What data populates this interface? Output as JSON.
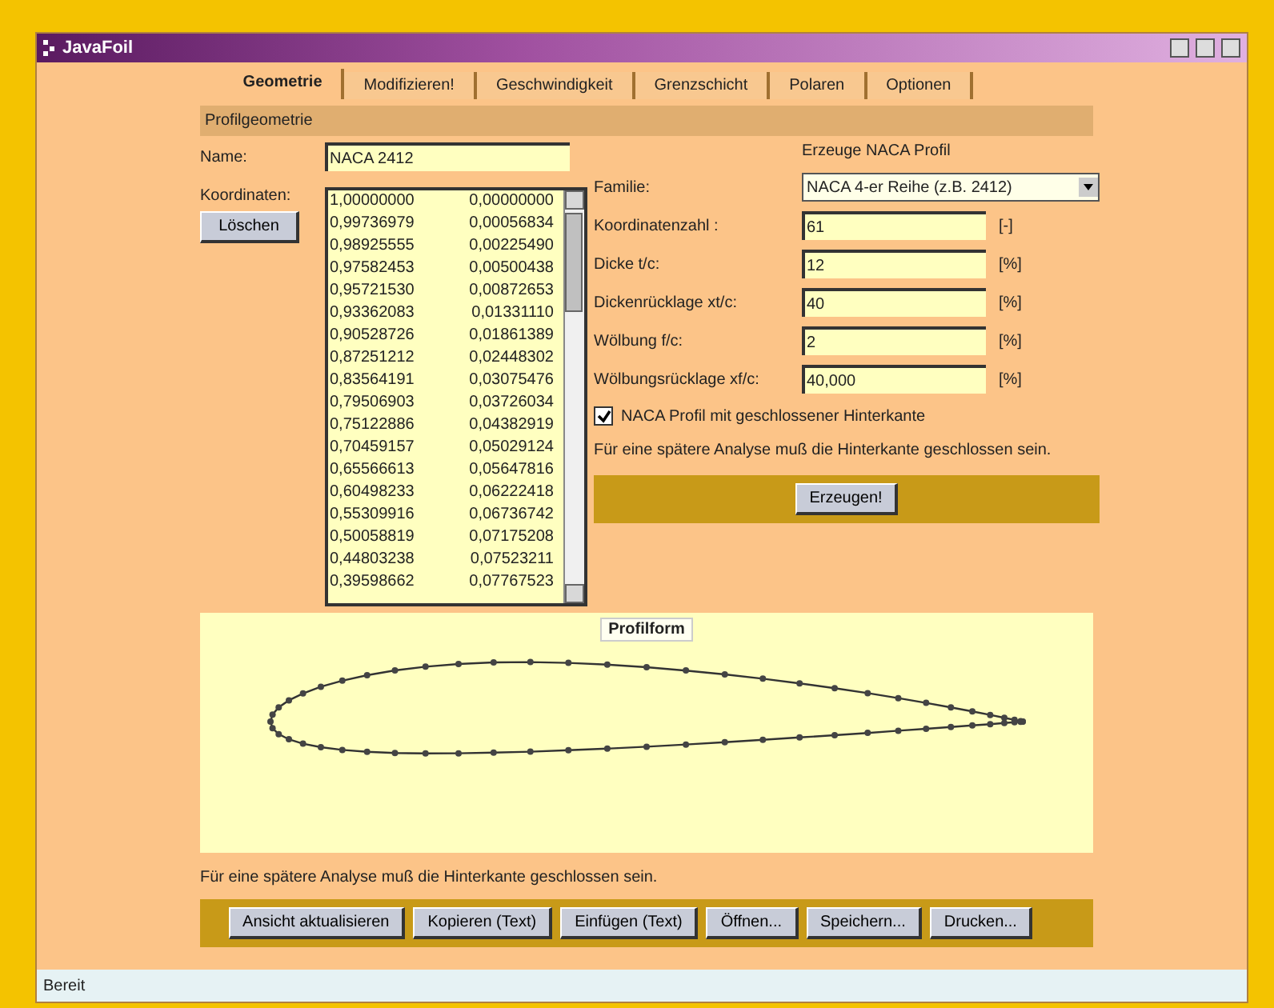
{
  "window": {
    "title": "JavaFoil"
  },
  "tabs": [
    {
      "label": "Geometrie",
      "selected": true
    },
    {
      "label": "Modifizieren!",
      "selected": false
    },
    {
      "label": "Geschwindigkeit",
      "selected": false
    },
    {
      "label": "Grenzschicht",
      "selected": false
    },
    {
      "label": "Polaren",
      "selected": false
    },
    {
      "label": "Optionen",
      "selected": false
    }
  ],
  "section_title": "Profilgeometrie",
  "name": {
    "label": "Name:",
    "value": "NACA 2412"
  },
  "coordinates": {
    "label": "Koordinaten:",
    "clear_button": "Löschen",
    "rows": [
      [
        "1,00000000",
        "0,00000000"
      ],
      [
        "0,99736979",
        "0,00056834"
      ],
      [
        "0,98925555",
        "0,00225490"
      ],
      [
        "0,97582453",
        "0,00500438"
      ],
      [
        "0,95721530",
        "0,00872653"
      ],
      [
        "0,93362083",
        "0,01331110"
      ],
      [
        "0,90528726",
        "0,01861389"
      ],
      [
        "0,87251212",
        "0,02448302"
      ],
      [
        "0,83564191",
        "0,03075476"
      ],
      [
        "0,79506903",
        "0,03726034"
      ],
      [
        "0,75122886",
        "0,04382919"
      ],
      [
        "0,70459157",
        "0,05029124"
      ],
      [
        "0,65566613",
        "0,05647816"
      ],
      [
        "0,60498233",
        "0,06222418"
      ],
      [
        "0,55309916",
        "0,06736742"
      ],
      [
        "0,50058819",
        "0,07175208"
      ],
      [
        "0,44803238",
        "0,07523211"
      ],
      [
        "0,39598662",
        "0,07767523"
      ]
    ]
  },
  "naca": {
    "title": "Erzeuge NACA Profil",
    "family_label": "Familie:",
    "family_value": "NACA 4-er Reihe (z.B. 2412)",
    "fields": [
      {
        "label": "Koordinatenzahl :",
        "value": "61",
        "unit": "[-]"
      },
      {
        "label": "Dicke  t/c:",
        "value": "12",
        "unit": "[%]"
      },
      {
        "label": "Dickenrücklage  xt/c:",
        "value": "40",
        "unit": "[%]"
      },
      {
        "label": "Wölbung  f/c:",
        "value": "2",
        "unit": "[%]"
      },
      {
        "label": "Wölbungsrücklage  xf/c:",
        "value": "40,000",
        "unit": "[%]"
      }
    ],
    "closed_te": {
      "label": "NACA Profil mit geschlossener Hinterkante",
      "checked": true
    },
    "hint": "Für eine spätere Analyse muß die Hinterkante geschlossen sein.",
    "generate_button": "Erzeugen!"
  },
  "plot": {
    "title": "Profilform"
  },
  "note": "Für eine spätere Analyse muß die Hinterkante geschlossen sein.",
  "buttons": [
    "Ansicht aktualisieren",
    "Kopieren (Text)",
    "Einfügen (Text)",
    "Öffnen...",
    "Speichern...",
    "Drucken..."
  ],
  "status_bar": "Bereit"
}
